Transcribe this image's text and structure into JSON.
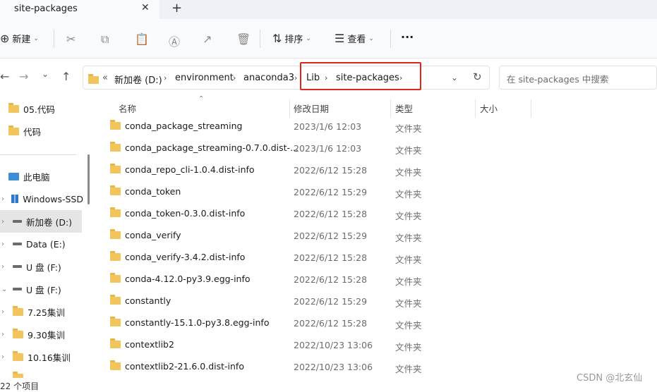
{
  "tab": {
    "title": "site-packages",
    "close": "✕",
    "new_tab": "+"
  },
  "toolbar": {
    "new_label": "新建",
    "sort_label": "排序",
    "view_label": "查看",
    "more": "···"
  },
  "breadcrumb": {
    "overflow": "«",
    "items": [
      "新加卷 (D:)",
      "environment",
      "anaconda3",
      "Lib",
      "site-packages"
    ]
  },
  "search": {
    "placeholder": "在 site-packages 中搜索"
  },
  "sidebar": {
    "items": [
      "05.代码",
      "代码",
      "此电脑",
      "Windows-SSD",
      "新加卷 (D:)",
      "Data (E:)",
      "U 盘 (F:)",
      "U 盘 (F:)",
      "7.25集训",
      "9.30集训",
      "10.16集训"
    ]
  },
  "columns": {
    "name": "名称",
    "date": "修改日期",
    "type": "类型",
    "size": "大小"
  },
  "files": [
    {
      "name": "conda_package_streaming",
      "date": "2023/1/6 12:03",
      "type": "文件夹"
    },
    {
      "name": "conda_package_streaming-0.7.0.dist-...",
      "date": "2023/1/6 12:03",
      "type": "文件夹"
    },
    {
      "name": "conda_repo_cli-1.0.4.dist-info",
      "date": "2022/6/12 15:28",
      "type": "文件夹"
    },
    {
      "name": "conda_token",
      "date": "2022/6/12 15:29",
      "type": "文件夹"
    },
    {
      "name": "conda_token-0.3.0.dist-info",
      "date": "2022/6/12 15:28",
      "type": "文件夹"
    },
    {
      "name": "conda_verify",
      "date": "2022/6/12 15:29",
      "type": "文件夹"
    },
    {
      "name": "conda_verify-3.4.2.dist-info",
      "date": "2022/6/12 15:28",
      "type": "文件夹"
    },
    {
      "name": "conda-4.12.0-py3.9.egg-info",
      "date": "2022/6/12 15:28",
      "type": "文件夹"
    },
    {
      "name": "constantly",
      "date": "2022/6/12 15:29",
      "type": "文件夹"
    },
    {
      "name": "constantly-15.1.0-py3.8.egg-info",
      "date": "2022/6/12 15:28",
      "type": "文件夹"
    },
    {
      "name": "contextlib2",
      "date": "2022/10/23 13:06",
      "type": "文件夹"
    },
    {
      "name": "contextlib2-21.6.0.dist-info",
      "date": "2022/10/23 13:06",
      "type": "文件夹"
    }
  ],
  "status": "22 个项目",
  "watermark": "CSDN @北玄仙",
  "colors": {
    "highlight_box": "#e0261a",
    "folder": "#f2c55c",
    "selected": "#e5e5e5"
  }
}
